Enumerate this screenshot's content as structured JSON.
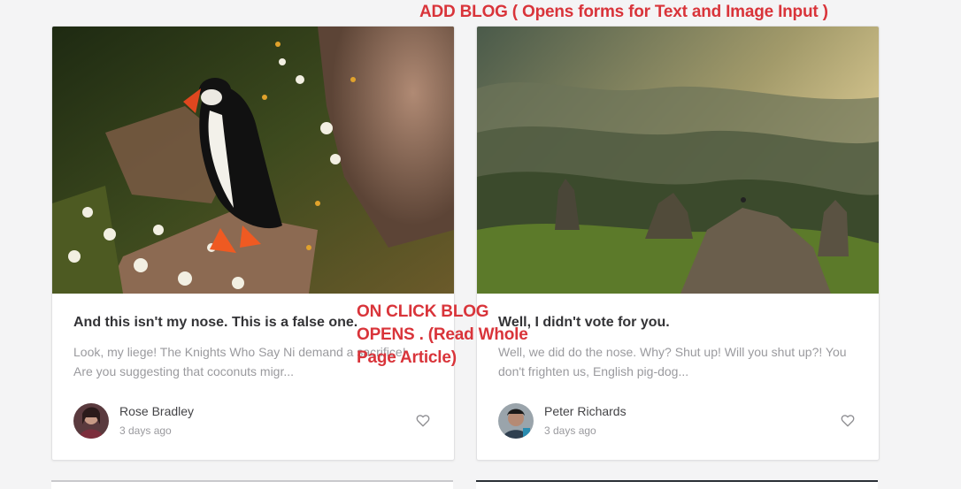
{
  "annotations": {
    "add_blog": "ADD BLOG ( Opens forms for Text and Image Input )",
    "on_click": "ON CLICK BLOG\nOPENS . (Read Whole\nPage Article)"
  },
  "posts": [
    {
      "title": "And this isn't my nose. This is a false one.",
      "excerpt": "Look, my liege! The Knights Who Say Ni demand a sacrifice! Are you suggesting that coconuts migr...",
      "author": "Rose Bradley",
      "date": "3 days ago",
      "image": "puffin-photo",
      "avatar": "avatar-rose"
    },
    {
      "title": "Well, I didn't vote for you.",
      "excerpt": "Well, we did do the nose. Why? Shut up! Will you shut up?! You don't frighten us, English pig-dog...",
      "author": "Peter Richards",
      "date": "3 days ago",
      "image": "mountain-landscape-photo",
      "avatar": "avatar-peter"
    }
  ],
  "colors": {
    "annotation": "#d9343a",
    "background": "#f4f4f5",
    "card": "#ffffff"
  }
}
